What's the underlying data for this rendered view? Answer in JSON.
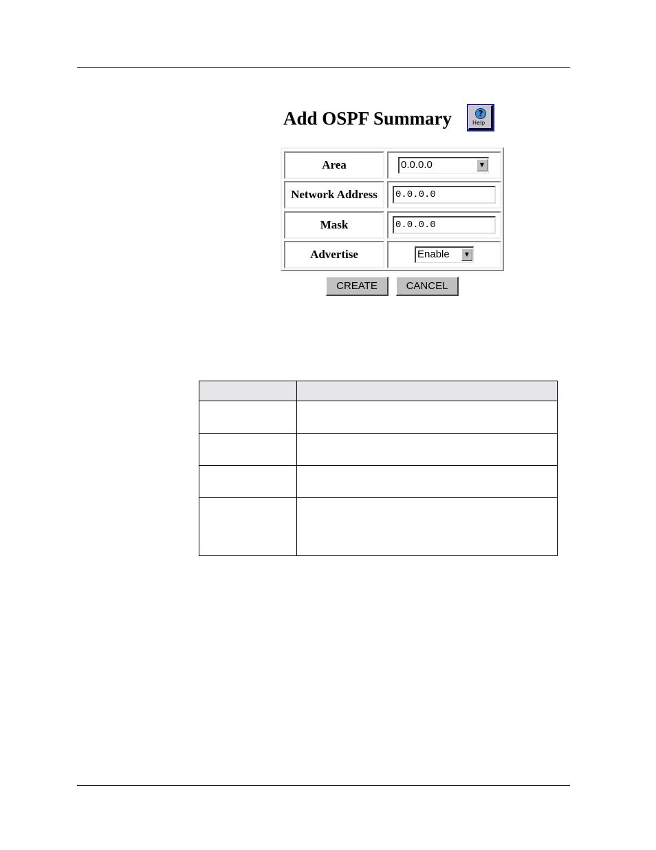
{
  "page": {
    "title": "Add OSPF Summary",
    "help_button": {
      "icon": "help-icon",
      "label": "Help"
    }
  },
  "form": {
    "fields": [
      {
        "label": "Area",
        "type": "select",
        "value": "0.0.0.0"
      },
      {
        "label": "Network Address",
        "type": "text",
        "value": "0.0.0.0"
      },
      {
        "label": "Mask",
        "type": "text",
        "value": "0.0.0.0"
      },
      {
        "label": "Advertise",
        "type": "select",
        "value": "Enable"
      }
    ],
    "buttons": {
      "create": "CREATE",
      "cancel": "CANCEL"
    }
  },
  "description_table": {
    "headers": [
      "",
      ""
    ],
    "rows": [
      [
        "",
        ""
      ],
      [
        "",
        ""
      ],
      [
        "",
        ""
      ],
      [
        "",
        ""
      ]
    ]
  },
  "colors": {
    "help_border": "#1a1ad6",
    "button_face": "#c0c0c0",
    "table_header_bg": "#e6e6e8"
  }
}
